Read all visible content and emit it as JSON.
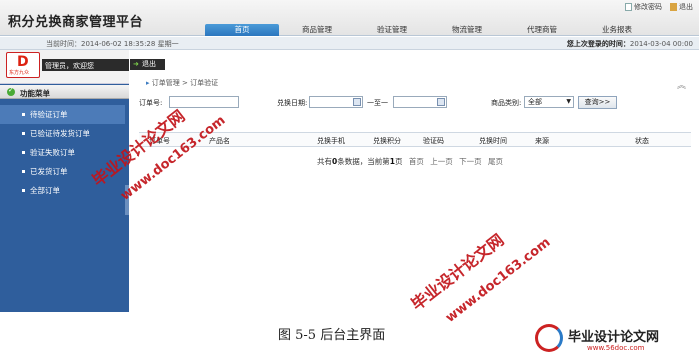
{
  "app": {
    "title": "积分兑换商家管理平台",
    "top_links": [
      "修改密码",
      "退出"
    ]
  },
  "nav": {
    "tabs": [
      "首页",
      "商品管理",
      "验证管理",
      "物流管理",
      "代理商管",
      "业务报表"
    ],
    "active_index": 0
  },
  "infobar": {
    "current_time_label": "当前时间：2014-06-02 18:35:28 星期一",
    "last_login_label": "您上次登录的时间：",
    "last_login_value": "2014-03-04 00:00"
  },
  "sidebar": {
    "logo_letter": "D",
    "logo_text": "东方九众",
    "admin_text": "管理员，欢迎您",
    "logout_label": "退出",
    "menu_title": "功能菜单",
    "items": [
      {
        "label": "待验证订单",
        "active": true
      },
      {
        "label": "已验证待发货订单",
        "active": false
      },
      {
        "label": "验证失败订单",
        "active": false
      },
      {
        "label": "已发货订单",
        "active": false
      },
      {
        "label": "全部订单",
        "active": false
      }
    ]
  },
  "main": {
    "breadcrumb": [
      "订单管理",
      "订单验证"
    ],
    "filters": {
      "order_no_label": "订单号:",
      "date_label": "兑换日期:",
      "to_label": "一至一",
      "category_label": "商品类别:",
      "category_value": "全部",
      "query_button": "查询>>"
    },
    "table_headers": [
      "订单号",
      "产品名",
      "兑换手机",
      "兑换积分",
      "验证码",
      "兑换时间",
      "来源",
      "状态"
    ],
    "pager": {
      "prefix": "共有",
      "count": "0",
      "middle": "条数据，当前第",
      "page": "1",
      "suffix": "页",
      "links": [
        "首页",
        "上一页",
        "下一页",
        "尾页"
      ]
    }
  },
  "watermarks": {
    "site_name": "毕业设计论文网",
    "url": "www.doc163.com"
  },
  "caption": "图 5-5  后台主界面",
  "footer_logo": {
    "name": "毕业设计论文网",
    "url": "www.56doc.com"
  }
}
